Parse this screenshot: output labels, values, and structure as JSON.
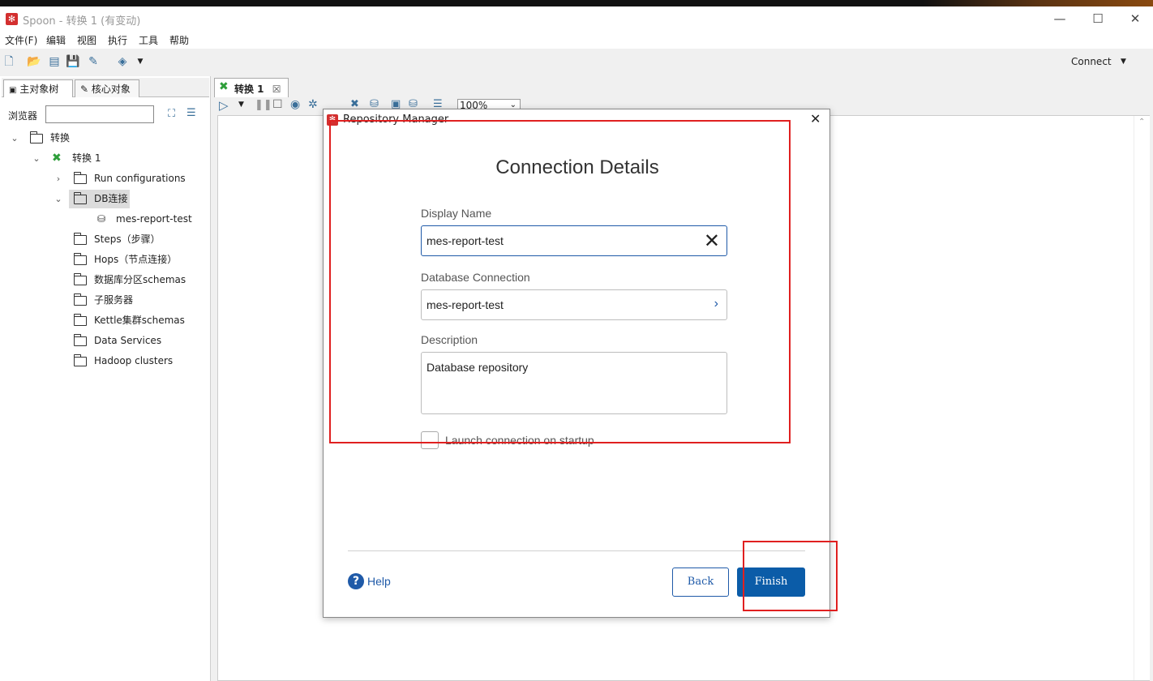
{
  "window": {
    "title": "Spoon - 转换 1 (有变动)",
    "minimize": "—",
    "maximize": "☐",
    "close": "✕"
  },
  "menu": [
    "文件(F)",
    "编辑",
    "视图",
    "执行",
    "工具",
    "帮助"
  ],
  "toolbar": {
    "connect_label": "Connect",
    "icons": [
      "new-file-icon",
      "open-icon",
      "explore-icon",
      "save-icon",
      "save-as-icon",
      "layers-icon"
    ]
  },
  "left_panel": {
    "tabs": [
      "主对象树",
      "核心对象"
    ],
    "browse_label": "浏览器",
    "search_value": "",
    "tree": [
      {
        "label": "转换",
        "level": 0,
        "expanded": true,
        "icon": "folder"
      },
      {
        "label": "转换 1",
        "level": 1,
        "expanded": true,
        "icon": "transform"
      },
      {
        "label": "Run configurations",
        "level": 2,
        "expanded": false,
        "icon": "folder"
      },
      {
        "label": "DB连接",
        "level": 2,
        "expanded": true,
        "icon": "folder",
        "selected": true
      },
      {
        "label": "mes-report-test",
        "level": 3,
        "icon": "database"
      },
      {
        "label": "Steps（步骤）",
        "level": 2,
        "icon": "folder"
      },
      {
        "label": "Hops（节点连接）",
        "level": 2,
        "icon": "folder"
      },
      {
        "label": "数据库分区schemas",
        "level": 2,
        "icon": "folder"
      },
      {
        "label": "子服务器",
        "level": 2,
        "icon": "folder"
      },
      {
        "label": "Kettle集群schemas",
        "level": 2,
        "icon": "folder"
      },
      {
        "label": "Data Services",
        "level": 2,
        "icon": "folder"
      },
      {
        "label": "Hadoop clusters",
        "level": 2,
        "icon": "folder"
      }
    ]
  },
  "editor": {
    "tab_label": "转换 1",
    "zoom": "100%"
  },
  "dialog": {
    "title": "Repository Manager",
    "heading": "Connection Details",
    "display_name_label": "Display Name",
    "display_name_value": "mes-report-test",
    "db_connection_label": "Database Connection",
    "db_connection_value": "mes-report-test",
    "description_label": "Description",
    "description_value": "Database repository",
    "launch_label": "Launch connection on startup",
    "launch_checked": false,
    "help_label": "Help",
    "back_label": "Back",
    "finish_label": "Finish"
  },
  "colors": {
    "accent": "#0b5ca8",
    "annotation_red": "#e02020",
    "logo_red": "#d32f2f"
  }
}
